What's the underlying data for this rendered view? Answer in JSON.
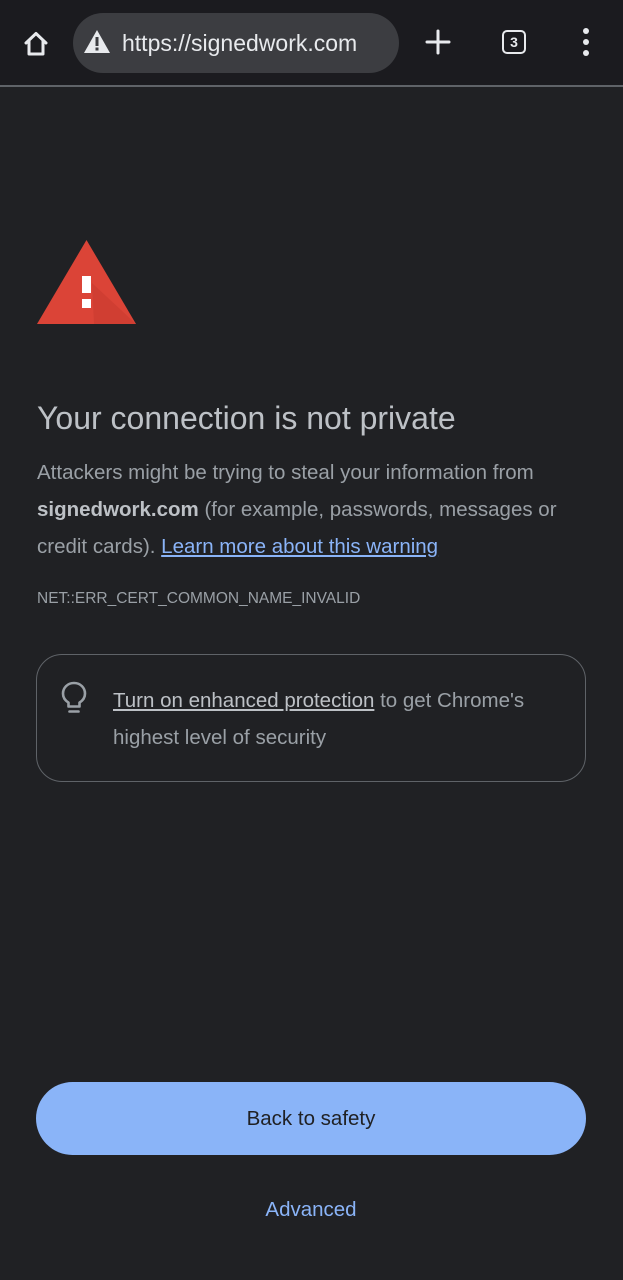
{
  "toolbar": {
    "home_icon": "home-icon",
    "security_icon": "not-secure-warning-icon",
    "url": "https://signedwork.com",
    "new_tab_icon": "plus-icon",
    "tab_count": "3",
    "menu_icon": "more-vert-icon"
  },
  "interstitial": {
    "icon": "red-warning-triangle-icon",
    "heading": "Your connection is not private",
    "explanation_before": "Attackers might be trying to steal your information from ",
    "domain": "signedwork.com",
    "explanation_after": " (for example, passwords, messages or credit cards). ",
    "learn_more_link": "Learn more about this warning",
    "error_code": "NET::ERR_CERT_COMMON_NAME_INVALID"
  },
  "enhanced_protection": {
    "icon": "lightbulb-icon",
    "link": "Turn on enhanced protection",
    "text": " to get Chrome's highest level of security"
  },
  "actions": {
    "back_to_safety": "Back to safety",
    "advanced": "Advanced"
  },
  "colors": {
    "background": "#202124",
    "toolbar": "#1b1b1f",
    "omnibox": "#3c3d41",
    "accent_blue": "#8ab4f8",
    "warning_red": "#db4437"
  }
}
